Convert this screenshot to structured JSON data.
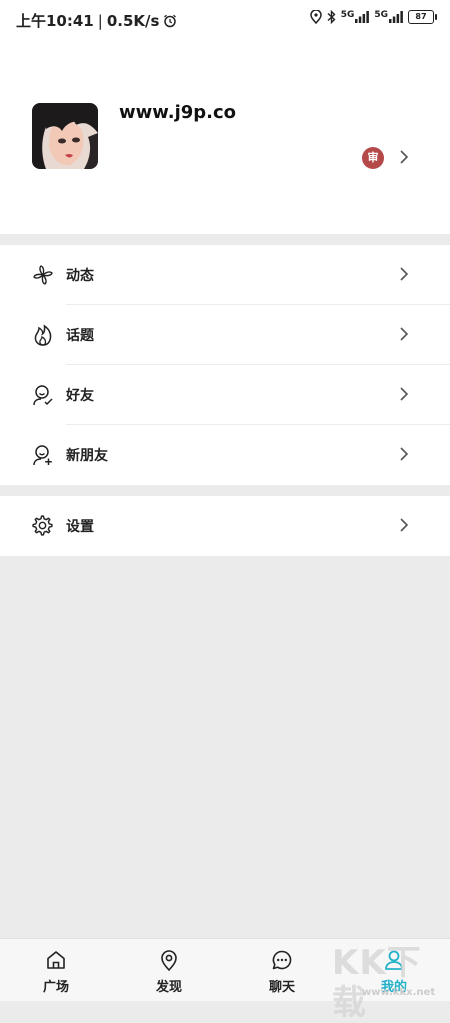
{
  "status_bar": {
    "time": "上午10:41",
    "separator": "|",
    "net_speed": "0.5K/s",
    "icons": [
      "alarm-icon",
      "location-icon",
      "bluetooth-icon",
      "signal-5g-icon",
      "signal-5g-icon"
    ],
    "signal_label": "5G",
    "battery": "87"
  },
  "profile": {
    "username": "www.j9p.co",
    "badge": "审"
  },
  "menu": {
    "group1": [
      {
        "label": "动态",
        "icon": "pinwheel-icon"
      },
      {
        "label": "话题",
        "icon": "flame-icon"
      },
      {
        "label": "好友",
        "icon": "friend-check-icon"
      },
      {
        "label": "新朋友",
        "icon": "add-friend-icon"
      }
    ],
    "group2": [
      {
        "label": "设置",
        "icon": "gear-icon"
      }
    ]
  },
  "bottom_nav": [
    {
      "label": "广场",
      "icon": "home-icon"
    },
    {
      "label": "发现",
      "icon": "location-pin-icon"
    },
    {
      "label": "聊天",
      "icon": "chat-bubble-icon"
    },
    {
      "label": "我的",
      "icon": "person-icon",
      "active": true
    }
  ],
  "watermark": {
    "text": "KK下载",
    "url": "www.kkx.net"
  },
  "colors": {
    "accent": "#23b1c9",
    "badge": "#b54848",
    "background": "#ebebeb"
  }
}
